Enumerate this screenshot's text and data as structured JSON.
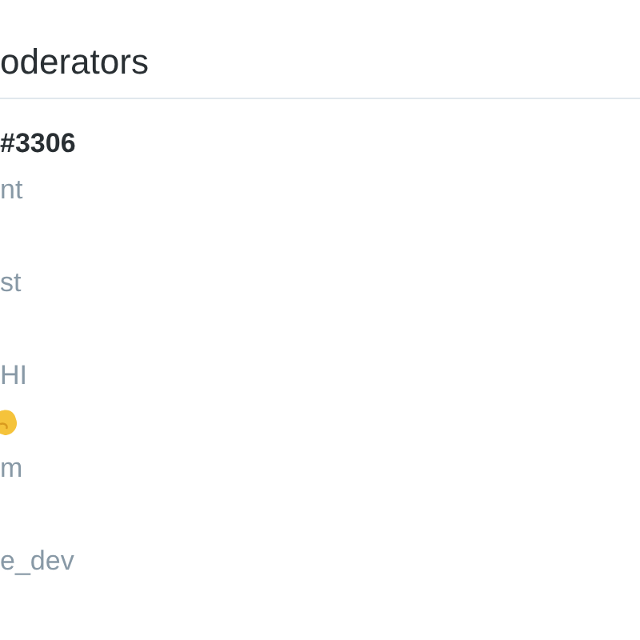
{
  "header": {
    "title": "oderators"
  },
  "groups": [
    {
      "lines": [
        {
          "kind": "name",
          "text": "#3306"
        },
        {
          "kind": "text",
          "text": "nt"
        }
      ]
    },
    {
      "lines": [
        {
          "kind": "text",
          "text": "st"
        }
      ]
    },
    {
      "lines": [
        {
          "kind": "text",
          "text": "HI"
        },
        {
          "kind": "emoji"
        },
        {
          "kind": "text",
          "text": "m"
        }
      ]
    },
    {
      "lines": [
        {
          "kind": "text",
          "text": "e_dev"
        }
      ]
    }
  ]
}
